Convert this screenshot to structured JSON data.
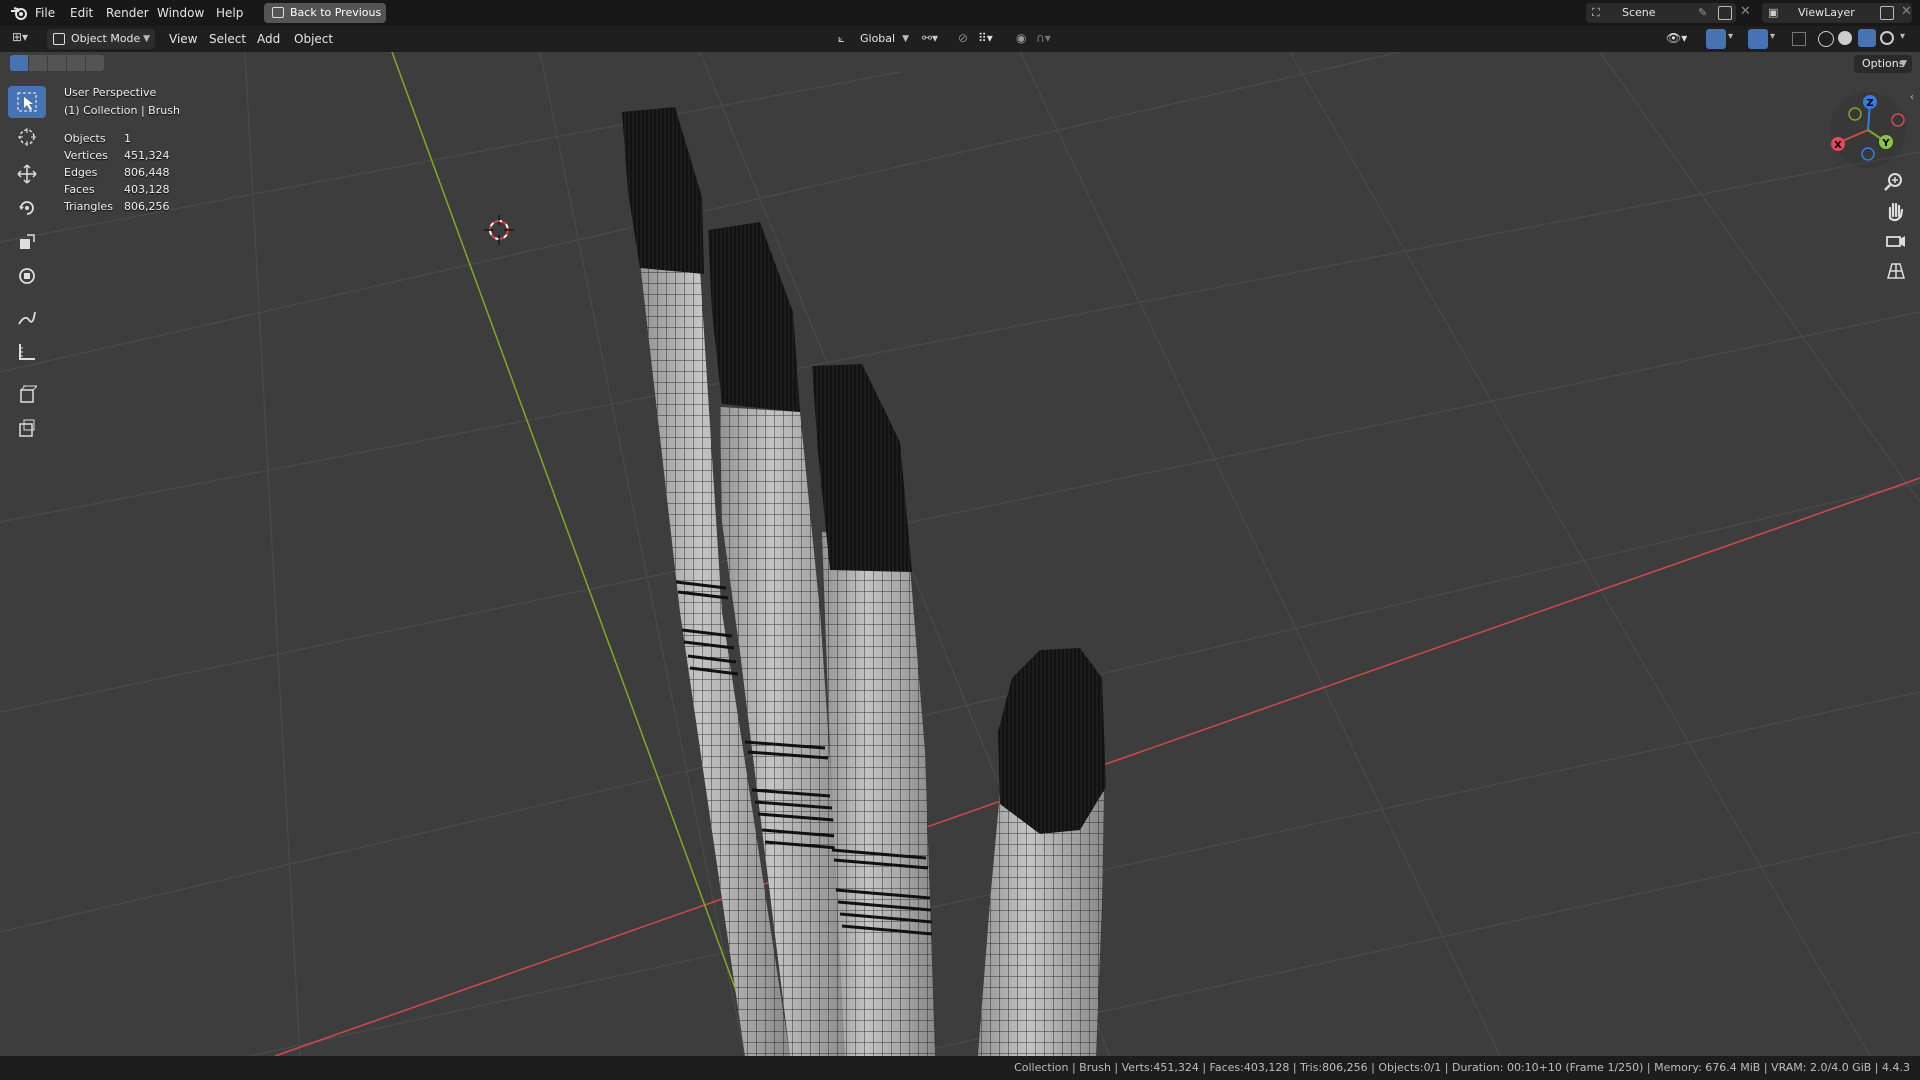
{
  "topbar": {
    "menus": [
      "File",
      "Edit",
      "Render",
      "Window",
      "Help"
    ],
    "back_button": "Back to Previous",
    "scene_name": "Scene",
    "view_layer": "ViewLayer"
  },
  "viewport_header": {
    "mode": "Object Mode",
    "menus": [
      "View",
      "Select",
      "Add",
      "Object"
    ],
    "transform_orientation": "Global",
    "options_label": "Options"
  },
  "overlay": {
    "perspective": "User Perspective",
    "collection": "(1) Collection | Brush",
    "stats": [
      {
        "label": "Objects",
        "value": "1"
      },
      {
        "label": "Vertices",
        "value": "451,324"
      },
      {
        "label": "Edges",
        "value": "806,448"
      },
      {
        "label": "Faces",
        "value": "403,128"
      },
      {
        "label": "Triangles",
        "value": "806,256"
      }
    ]
  },
  "gizmo": {
    "x_label": "X",
    "y_label": "Y",
    "z_label": "Z"
  },
  "toolbar": {
    "tools": [
      "select-box",
      "cursor",
      "move",
      "rotate",
      "scale",
      "transform",
      "annotate",
      "measure",
      "add-cube",
      "extrude"
    ]
  },
  "statusbar": {
    "text": "Collection | Brush | Verts:451,324 | Faces:403,128 | Tris:806,256 | Objects:0/1 | Duration: 00:10+10 (Frame 1/250) | Memory: 676.4 MiB | VRAM: 2.0/4.0 GiB | 4.4.3"
  },
  "colors": {
    "accent": "#4772b3",
    "viewport_bg": "#3d3d3d",
    "x_axis": "#d04a4a",
    "y_axis": "#7fa82a",
    "z_axis": "#3a7bdc"
  }
}
